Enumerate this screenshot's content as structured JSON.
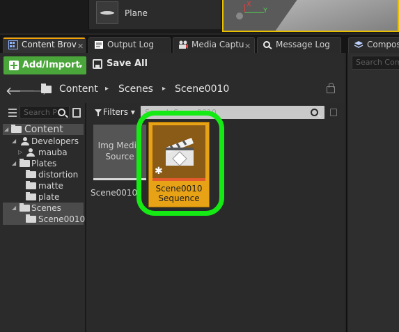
{
  "top_panel": {
    "plane_label": "Plane",
    "help_icon_glyph": "?",
    "viewport_axes": {
      "x": "X",
      "y": "Y"
    }
  },
  "tabs": [
    {
      "label": "Content Brov",
      "icon": "content-browser-icon",
      "close": "✕",
      "active": true
    },
    {
      "label": "Output Log",
      "icon": "output-log-icon",
      "close": "",
      "active": false
    },
    {
      "label": "Media Captu",
      "icon": "media-capture-icon",
      "close": "✕",
      "active": false
    },
    {
      "label": "Message Log",
      "icon": "message-log-icon",
      "close": "",
      "active": false
    },
    {
      "label": "Compos",
      "icon": "layers-icon",
      "close": "",
      "active": false
    }
  ],
  "right_panel": {
    "search_placeholder": "Search Comp"
  },
  "toolbar": {
    "add_import_label": "Add/Import",
    "add_import_caret": "▾",
    "save_all_label": "Save All"
  },
  "breadcrumbs": {
    "back_glyph": "🡐",
    "forward_glyph": "🡒",
    "items": [
      "Content",
      "Scenes",
      "Scene0010"
    ],
    "separator": "▸"
  },
  "tree": {
    "search_placeholder": "Search P",
    "items": [
      {
        "label": "Content",
        "icon": "folder-open",
        "arrow": "◢",
        "depth": 0,
        "selected": true
      },
      {
        "label": "Developers",
        "icon": "user",
        "arrow": "◢",
        "depth": 1,
        "selected": false
      },
      {
        "label": "mauba",
        "icon": "user",
        "arrow": "▷",
        "depth": 2,
        "selected": false
      },
      {
        "label": "Plates",
        "icon": "folder-open",
        "arrow": "◢",
        "depth": 1,
        "selected": false
      },
      {
        "label": "distortion",
        "icon": "folder",
        "arrow": "",
        "depth": 2,
        "selected": false
      },
      {
        "label": "matte",
        "icon": "folder",
        "arrow": "",
        "depth": 2,
        "selected": false
      },
      {
        "label": "plate",
        "icon": "folder",
        "arrow": "",
        "depth": 2,
        "selected": false
      },
      {
        "label": "Scenes",
        "icon": "folder-open",
        "arrow": "◢",
        "depth": 1,
        "selected": true
      },
      {
        "label": "Scene0010",
        "icon": "folder",
        "arrow": "",
        "depth": 2,
        "selected": true
      }
    ]
  },
  "assets": {
    "filters_label": "Filters",
    "filters_caret": "▾",
    "search_placeholder": "Search Scene0010",
    "tiles": [
      {
        "thumb_label_1": "Img Media",
        "thumb_label_2": "Source",
        "name": "Scene0010"
      },
      {
        "name_line_1": "Scene0010",
        "name_line_2": "Sequence",
        "modified_marker": "✱",
        "icon": "clapperboard-icon"
      }
    ]
  },
  "colors": {
    "add_button": "#4aa53a",
    "sequence_tile": "#e8a216",
    "highlight": "#15ea15",
    "viewport_border": "#e8c000",
    "active_tab_accent": "#f0a000"
  }
}
